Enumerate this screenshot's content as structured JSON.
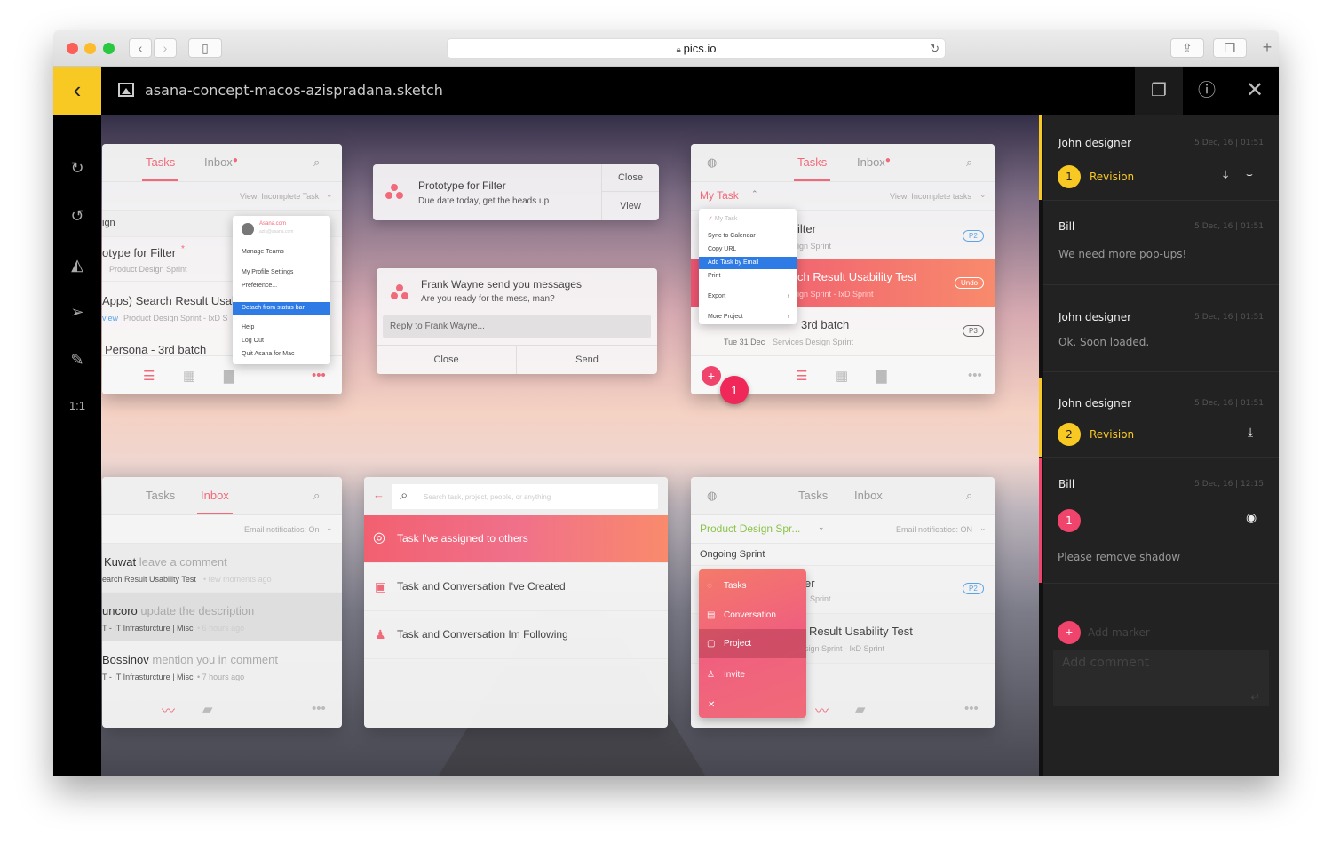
{
  "browser": {
    "url": "pics.io",
    "back": "‹",
    "forward": "›",
    "new_tab": "+"
  },
  "app": {
    "filename": "asana-concept-macos-azispradana.sketch",
    "back_icon": "‹",
    "one_to_one": "1:1"
  },
  "colors": {
    "accent_yellow": "#f8c823",
    "accent_pink": "#f0446c",
    "asana_pink": "#f06a7a",
    "panel_bg": "#222222"
  },
  "card_tasks_left": {
    "tab_tasks": "Tasks",
    "tab_inbox": "Inbox",
    "view": "View: Incomplete Task",
    "group": "ign",
    "rows": [
      {
        "title": "otype for Filter",
        "sub": "Product Design Sprint"
      },
      {
        "title": "Apps) Search Result Usabi",
        "tag": "view",
        "sub": "Product Design Sprint  -  IxD S"
      },
      {
        "title": "Persona - 3rd batch"
      }
    ],
    "menu": {
      "account": "Asana.com",
      "email": "azis@asana.com",
      "items": [
        "Manage Teams",
        "My Profile Settings",
        "Preference...",
        "Detach from status bar",
        "Help",
        "Log Out",
        "Quit Asana for Mac"
      ]
    }
  },
  "notif_filter": {
    "title": "Prototype for Filter",
    "body": "Due date today, get the heads up",
    "close": "Close",
    "view": "View"
  },
  "notif_message": {
    "title": "Frank Wayne send you messages",
    "body": "Are you ready for the mess, man?",
    "reply_placeholder": "Reply to Frank Wayne...",
    "close": "Close",
    "send": "Send"
  },
  "card_tasks_right": {
    "tab_tasks": "Tasks",
    "tab_inbox": "Inbox",
    "my_task": "My Task",
    "view": "View: Incomplete tasks",
    "rows": [
      {
        "title": "ilter",
        "sub": "ign Sprint",
        "badge": "P2"
      },
      {
        "title": "ch Result Usability Test",
        "sub": "ign Sprint  -  IxD Sprint",
        "badge": "Undo"
      },
      {
        "title": "3rd batch",
        "date": "Tue 31 Dec",
        "sub": "Services Design Sprint",
        "badge": "P3"
      }
    ],
    "menu": [
      "My Task",
      "Sync to Calendar",
      "Copy URL",
      "Add Task by Email",
      "Print",
      "Export",
      "More Project"
    ],
    "marker": "1"
  },
  "card_inbox": {
    "tab_tasks": "Tasks",
    "tab_inbox": "Inbox",
    "email": "Email notificatios: On",
    "rows": [
      {
        "who": "Kuwat",
        "action": " leave a comment",
        "ctx": "earch Result Usability Test",
        "time": "few moments ago"
      },
      {
        "who": "uncoro",
        "action": " update the description",
        "ctx": "T - IT Infrasturcture | Misc",
        "time": "6 hours ago"
      },
      {
        "who": "Bossinov",
        "action": " mention you in comment",
        "ctx": "T - IT Infrasturcture | Misc",
        "time": "7 hours ago"
      }
    ]
  },
  "card_search": {
    "placeholder": "Search task, project, people, or anything",
    "items": [
      "Task I've assigned to others",
      "Task and Conversation I've Created",
      "Task and Conversation Im Following"
    ]
  },
  "card_project": {
    "tab_tasks": "Tasks",
    "tab_inbox": "Inbox",
    "project": "Product Design Spr...",
    "email": "Email notificatios: ON",
    "section": "Ongoing Sprint",
    "rows": [
      {
        "title": "er",
        "sub": "Sprint",
        "badge": "P2"
      },
      {
        "title": "Result Usability Test",
        "sub": "sign Sprint  -  IxD Sprint"
      }
    ],
    "menu": [
      "Tasks",
      "Conversation",
      "Project",
      "Invite"
    ]
  },
  "comments": [
    {
      "author": "John designer",
      "time": "5 Dec, 16 | 01:51",
      "marker": "1",
      "label": "Revision"
    },
    {
      "author": "Bill",
      "time": "5 Dec, 16 | 01:51",
      "text": "We need more pop-ups!"
    },
    {
      "author": "John designer",
      "time": "5 Dec, 16 | 01:51",
      "text": "Ok. Soon loaded."
    },
    {
      "author": "John designer",
      "time": "5 Dec, 16 | 01:51",
      "marker": "2",
      "label": "Revision"
    },
    {
      "author": "Bill",
      "time": "5 Dec, 16 | 12:15",
      "marker": "1",
      "text": "Please remove shadow"
    }
  ],
  "composer": {
    "add_marker": "Add marker",
    "placeholder": "Add comment"
  }
}
